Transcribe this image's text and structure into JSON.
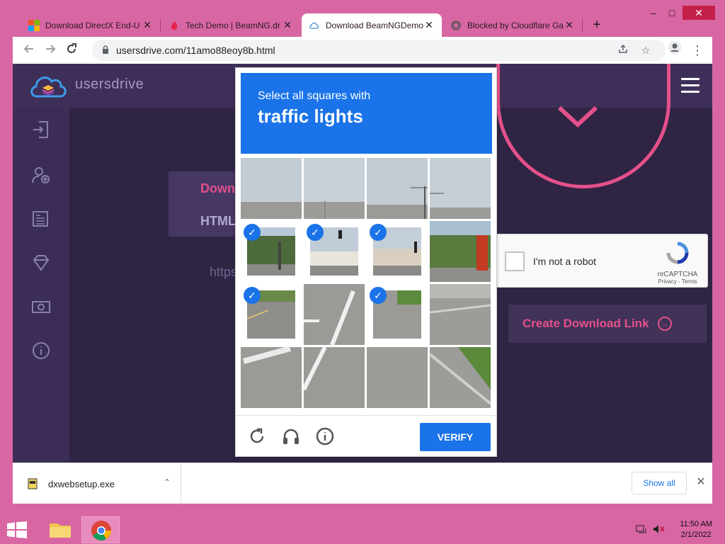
{
  "browser": {
    "tabs": [
      {
        "title": "Download DirectX End-U",
        "favicon": "windows-logo-icon"
      },
      {
        "title": "Tech Demo | BeamNG.dr",
        "favicon": "flame-icon"
      },
      {
        "title": "Download BeamNGDemo",
        "favicon": "cloud-icon"
      },
      {
        "title": "Blocked by Cloudflare Ga",
        "favicon": "globe-icon"
      }
    ],
    "active_tab_index": 2,
    "url": "usersdrive.com/11amo88eoy8b.html",
    "window_controls": {
      "minimize": "–",
      "maximize": "□",
      "close": "✕"
    },
    "new_tab": "+"
  },
  "site": {
    "logo_text": "usersdrive",
    "menu": {
      "download_link": "Download link",
      "html_code": "HTML code"
    },
    "url_ghost": "https://usersd",
    "create_link": "Create Download Link",
    "accent": "#e4508b"
  },
  "recaptcha_widget": {
    "label": "I'm not a robot",
    "brand": "reCAPTCHA",
    "links": "Privacy - Terms"
  },
  "captcha": {
    "instruction": "Select all squares with",
    "object": "traffic lights",
    "selected_cells": [
      4,
      5,
      6,
      8,
      10
    ],
    "verify_label": "VERIFY",
    "footer_icons": [
      "reload-icon",
      "audio-icon",
      "info-icon"
    ]
  },
  "downloads": {
    "file_name": "dxwebsetup.exe",
    "show_all": "Show all"
  },
  "taskbar": {
    "time": "11:50 AM",
    "date": "2/1/2022"
  }
}
